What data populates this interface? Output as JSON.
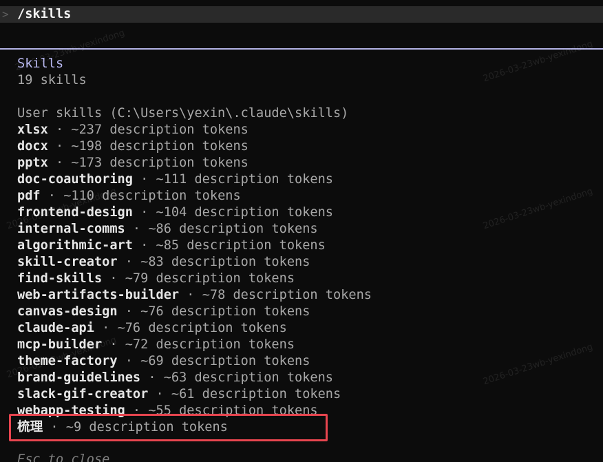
{
  "prompt": {
    "caret": ">",
    "command": "/skills"
  },
  "panel": {
    "title": "Skills",
    "count": "19 skills",
    "section_header": "User skills (C:\\Users\\yexin\\.claude\\skills)",
    "separator": " · ",
    "skills": [
      {
        "name": "xlsx",
        "tokens": "~237 description tokens"
      },
      {
        "name": "docx",
        "tokens": "~198 description tokens"
      },
      {
        "name": "pptx",
        "tokens": "~173 description tokens"
      },
      {
        "name": "doc-coauthoring",
        "tokens": "~111 description tokens"
      },
      {
        "name": "pdf",
        "tokens": "~110 description tokens"
      },
      {
        "name": "frontend-design",
        "tokens": "~104 description tokens"
      },
      {
        "name": "internal-comms",
        "tokens": "~86 description tokens"
      },
      {
        "name": "algorithmic-art",
        "tokens": "~85 description tokens"
      },
      {
        "name": "skill-creator",
        "tokens": "~83 description tokens"
      },
      {
        "name": "find-skills",
        "tokens": "~79 description tokens"
      },
      {
        "name": "web-artifacts-builder",
        "tokens": "~78 description tokens"
      },
      {
        "name": "canvas-design",
        "tokens": "~76 description tokens"
      },
      {
        "name": "claude-api",
        "tokens": "~76 description tokens"
      },
      {
        "name": "mcp-builder",
        "tokens": "~72 description tokens"
      },
      {
        "name": "theme-factory",
        "tokens": "~69 description tokens"
      },
      {
        "name": "brand-guidelines",
        "tokens": "~63 description tokens"
      },
      {
        "name": "slack-gif-creator",
        "tokens": "~61 description tokens"
      },
      {
        "name": "webapp-testing",
        "tokens": "~55 description tokens"
      },
      {
        "name": "梳理",
        "tokens": "~9 description tokens"
      }
    ],
    "footer": "Esc to close"
  },
  "watermark": "2026-03-23wb-yexindong",
  "colors": {
    "background": "#0c0c0c",
    "prompt_bar": "#2a2a2a",
    "accent": "#b8b8f0",
    "highlight_border": "#e8454f"
  }
}
